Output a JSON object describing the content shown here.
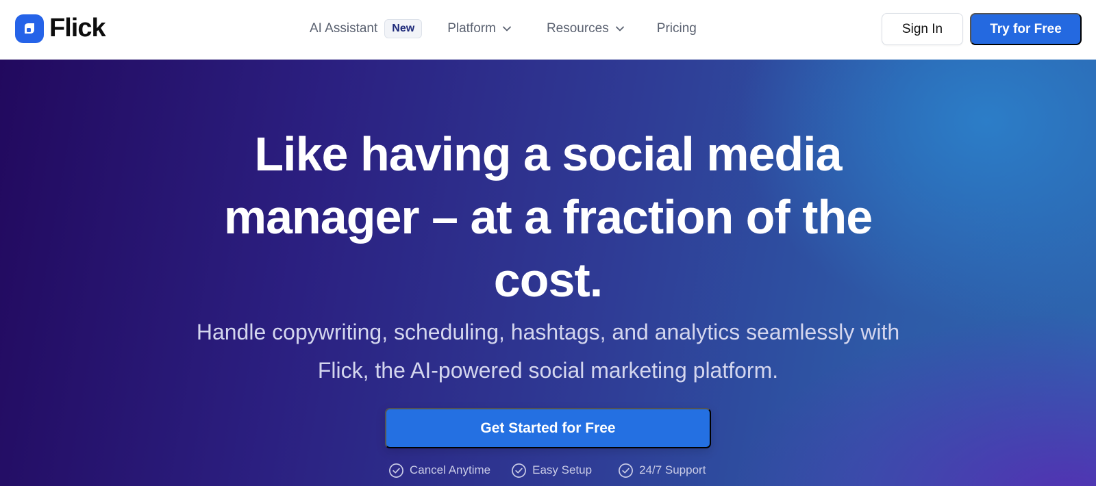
{
  "navbar": {
    "logo_text": "Flick",
    "links": {
      "ai_assistant": "AI Assistant",
      "new_badge": "New",
      "platform": "Platform",
      "resources": "Resources",
      "pricing": "Pricing"
    },
    "sign_in_label": "Sign In",
    "try_label": "Try for Free"
  },
  "hero": {
    "headline": "Like having a social media manager – at a fraction of the cost.",
    "subtext": "Handle copywriting, scheduling, hashtags, and analytics seamlessly with Flick, the AI-powered social marketing platform.",
    "cta_label": "Get Started for Free",
    "features": [
      "Cancel Anytime",
      "Easy Setup",
      "24/7 Support"
    ]
  },
  "colors": {
    "brand_blue": "#2469e0",
    "hero_start": "#22095e",
    "hero_end": "#2d66b0",
    "badge_text": "#1e2a7a"
  },
  "icons": {
    "logo": "flick-logo-icon",
    "dropdown": "chevron-down-icon",
    "feature_check": "check-circle-icon"
  }
}
